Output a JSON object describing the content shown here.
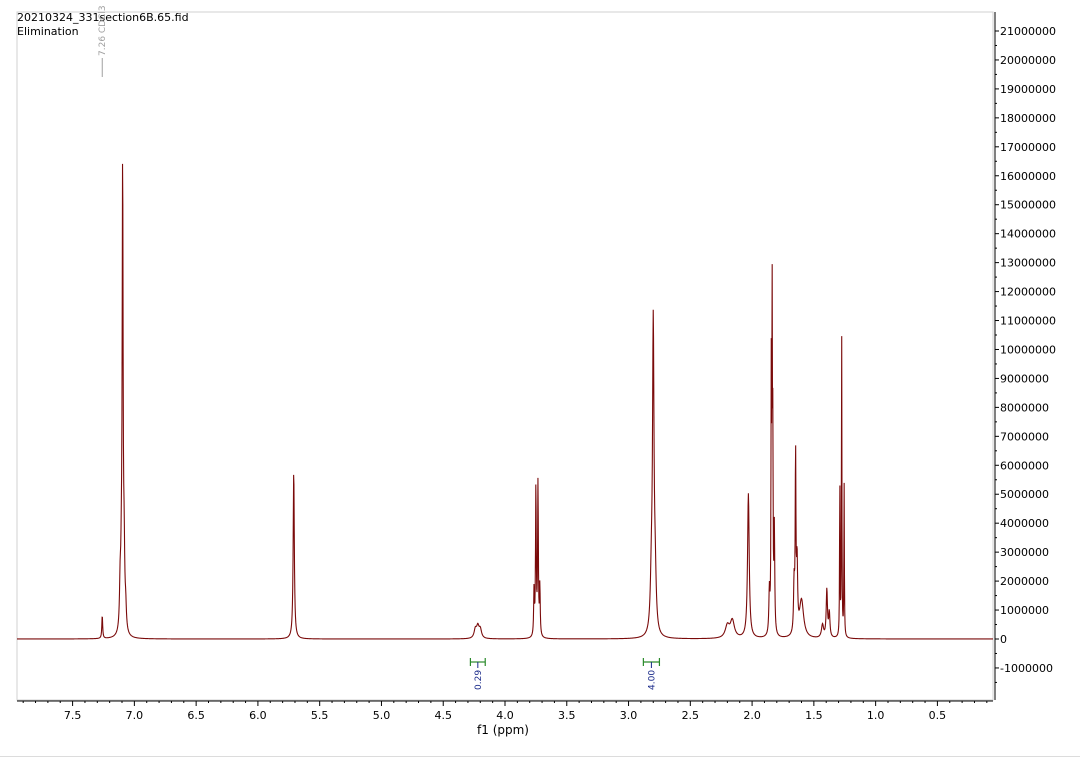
{
  "header": {
    "file_name": "20210324_331section6B.65.fid",
    "subtitle": "Elimination"
  },
  "colors": {
    "spectrum": "#7a0a0a",
    "integral": "#2a8a2a",
    "integral_value": "#1a2a8a",
    "axis": "#000000",
    "reference_label": "#a0a0a0"
  },
  "chart_data": {
    "type": "line",
    "title": "",
    "xlabel": "f1 (ppm)",
    "ylabel": "",
    "x_reversed": true,
    "xlim": [
      7.95,
      0.05
    ],
    "ylim": [
      -1950000,
      21500000
    ],
    "grid": false,
    "x_ticks": [
      {
        "value": 7.5,
        "label": "7.5"
      },
      {
        "value": 7.0,
        "label": "7.0"
      },
      {
        "value": 6.5,
        "label": "6.5"
      },
      {
        "value": 6.0,
        "label": "6.0"
      },
      {
        "value": 5.5,
        "label": "5.5"
      },
      {
        "value": 5.0,
        "label": "5.0"
      },
      {
        "value": 4.5,
        "label": "4.5"
      },
      {
        "value": 4.0,
        "label": "4.0"
      },
      {
        "value": 3.5,
        "label": "3.5"
      },
      {
        "value": 3.0,
        "label": "3.0"
      },
      {
        "value": 2.5,
        "label": "2.5"
      },
      {
        "value": 2.0,
        "label": "2.0"
      },
      {
        "value": 1.5,
        "label": "1.5"
      },
      {
        "value": 1.0,
        "label": "1.0"
      },
      {
        "value": 0.5,
        "label": "0.5"
      }
    ],
    "y_ticks": [
      {
        "value": 21000000,
        "label": "21000000"
      },
      {
        "value": 20000000,
        "label": "20000000"
      },
      {
        "value": 19000000,
        "label": "19000000"
      },
      {
        "value": 18000000,
        "label": "18000000"
      },
      {
        "value": 17000000,
        "label": "17000000"
      },
      {
        "value": 16000000,
        "label": "16000000"
      },
      {
        "value": 15000000,
        "label": "15000000"
      },
      {
        "value": 14000000,
        "label": "14000000"
      },
      {
        "value": 13000000,
        "label": "13000000"
      },
      {
        "value": 12000000,
        "label": "12000000"
      },
      {
        "value": 11000000,
        "label": "11000000"
      },
      {
        "value": 10000000,
        "label": "10000000"
      },
      {
        "value": 9000000,
        "label": "9000000"
      },
      {
        "value": 8000000,
        "label": "8000000"
      },
      {
        "value": 7000000,
        "label": "7000000"
      },
      {
        "value": 6000000,
        "label": "6000000"
      },
      {
        "value": 5000000,
        "label": "5000000"
      },
      {
        "value": 4000000,
        "label": "4000000"
      },
      {
        "value": 3000000,
        "label": "3000000"
      },
      {
        "value": 2000000,
        "label": "2000000"
      },
      {
        "value": 1000000,
        "label": "1000000"
      },
      {
        "value": 0,
        "label": "0"
      },
      {
        "value": -1000000,
        "label": "-1000000"
      }
    ],
    "peaks": [
      {
        "ppm": 7.26,
        "height": 800000,
        "width": 0.004
      },
      {
        "ppm": 7.115,
        "height": 1500000,
        "width": 0.006
      },
      {
        "ppm": 7.105,
        "height": 1700000,
        "width": 0.006
      },
      {
        "ppm": 7.095,
        "height": 15800000,
        "width": 0.0045
      },
      {
        "ppm": 7.083,
        "height": 2400000,
        "width": 0.006
      },
      {
        "ppm": 7.07,
        "height": 700000,
        "width": 0.006
      },
      {
        "ppm": 5.71,
        "height": 5800000,
        "width": 0.0055
      },
      {
        "ppm": 4.24,
        "height": 300000,
        "width": 0.012
      },
      {
        "ppm": 4.22,
        "height": 380000,
        "width": 0.012
      },
      {
        "ppm": 4.2,
        "height": 300000,
        "width": 0.012
      },
      {
        "ppm": 3.765,
        "height": 1600000,
        "width": 0.0035
      },
      {
        "ppm": 3.75,
        "height": 5200000,
        "width": 0.0035
      },
      {
        "ppm": 3.733,
        "height": 5300000,
        "width": 0.0035
      },
      {
        "ppm": 3.718,
        "height": 1700000,
        "width": 0.0035
      },
      {
        "ppm": 2.815,
        "height": 1700000,
        "width": 0.01
      },
      {
        "ppm": 2.8,
        "height": 10300000,
        "width": 0.007
      },
      {
        "ppm": 2.785,
        "height": 1800000,
        "width": 0.01
      },
      {
        "ppm": 2.2,
        "height": 420000,
        "width": 0.02
      },
      {
        "ppm": 2.16,
        "height": 600000,
        "width": 0.02
      },
      {
        "ppm": 2.03,
        "height": 5000000,
        "width": 0.008
      },
      {
        "ppm": 1.86,
        "height": 1500000,
        "width": 0.005
      },
      {
        "ppm": 1.845,
        "height": 8600000,
        "width": 0.0025
      },
      {
        "ppm": 1.838,
        "height": 11400000,
        "width": 0.0025
      },
      {
        "ppm": 1.832,
        "height": 6200000,
        "width": 0.0025
      },
      {
        "ppm": 1.82,
        "height": 3600000,
        "width": 0.004
      },
      {
        "ppm": 1.66,
        "height": 1700000,
        "width": 0.005
      },
      {
        "ppm": 1.648,
        "height": 6100000,
        "width": 0.0035
      },
      {
        "ppm": 1.636,
        "height": 2400000,
        "width": 0.005
      },
      {
        "ppm": 1.6,
        "height": 1300000,
        "width": 0.02
      },
      {
        "ppm": 1.43,
        "height": 450000,
        "width": 0.01
      },
      {
        "ppm": 1.395,
        "height": 1650000,
        "width": 0.006
      },
      {
        "ppm": 1.375,
        "height": 850000,
        "width": 0.006
      },
      {
        "ppm": 1.29,
        "height": 5500000,
        "width": 0.0022
      },
      {
        "ppm": 1.275,
        "height": 10800000,
        "width": 0.0022
      },
      {
        "ppm": 1.255,
        "height": 5300000,
        "width": 0.0022
      }
    ],
    "integrals": [
      {
        "from": 4.28,
        "to": 4.16,
        "value": "0.29"
      },
      {
        "from": 2.88,
        "to": 2.75,
        "value": "4.00"
      }
    ],
    "reference": {
      "ppm": 7.26,
      "label": "7.26 CDCl3"
    }
  }
}
